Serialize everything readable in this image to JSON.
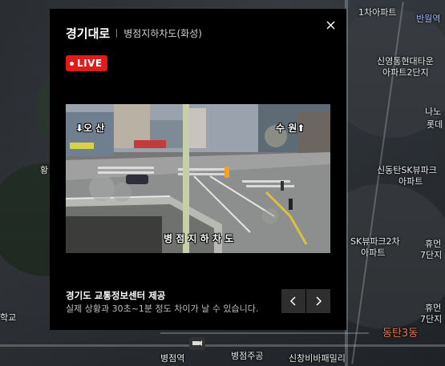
{
  "map": {
    "labels": [
      "1차아파트",
      "반월역",
      "신영통현대타운",
      "아파트2단지",
      "나노",
      "롯데",
      "신동탄SK뷰파크",
      "아파트",
      "SK뷰파크2차",
      "아파트",
      "휴먼",
      "7단지",
      "휴먼",
      "7단지",
      "동탄3동",
      "병점역",
      "병점주공",
      "신창비바패밀리",
      "학교",
      "황"
    ]
  },
  "modal": {
    "title": "경기대로",
    "subtitle": "병점지하차도(화성)",
    "live_label": "LIVE",
    "video": {
      "label_left": "⬇오 산",
      "label_right": "수 원⬆",
      "label_bottom": "병 점 지 하 차 도"
    },
    "source": "경기도 교통정보센터 제공",
    "note": "실제 상황과 30초~1분 정도 차이가 날 수 있습니다."
  },
  "icons": {
    "close": "close-icon",
    "prev": "chevron-left-icon",
    "next": "chevron-right-icon",
    "live_dot": "live-dot-icon"
  }
}
